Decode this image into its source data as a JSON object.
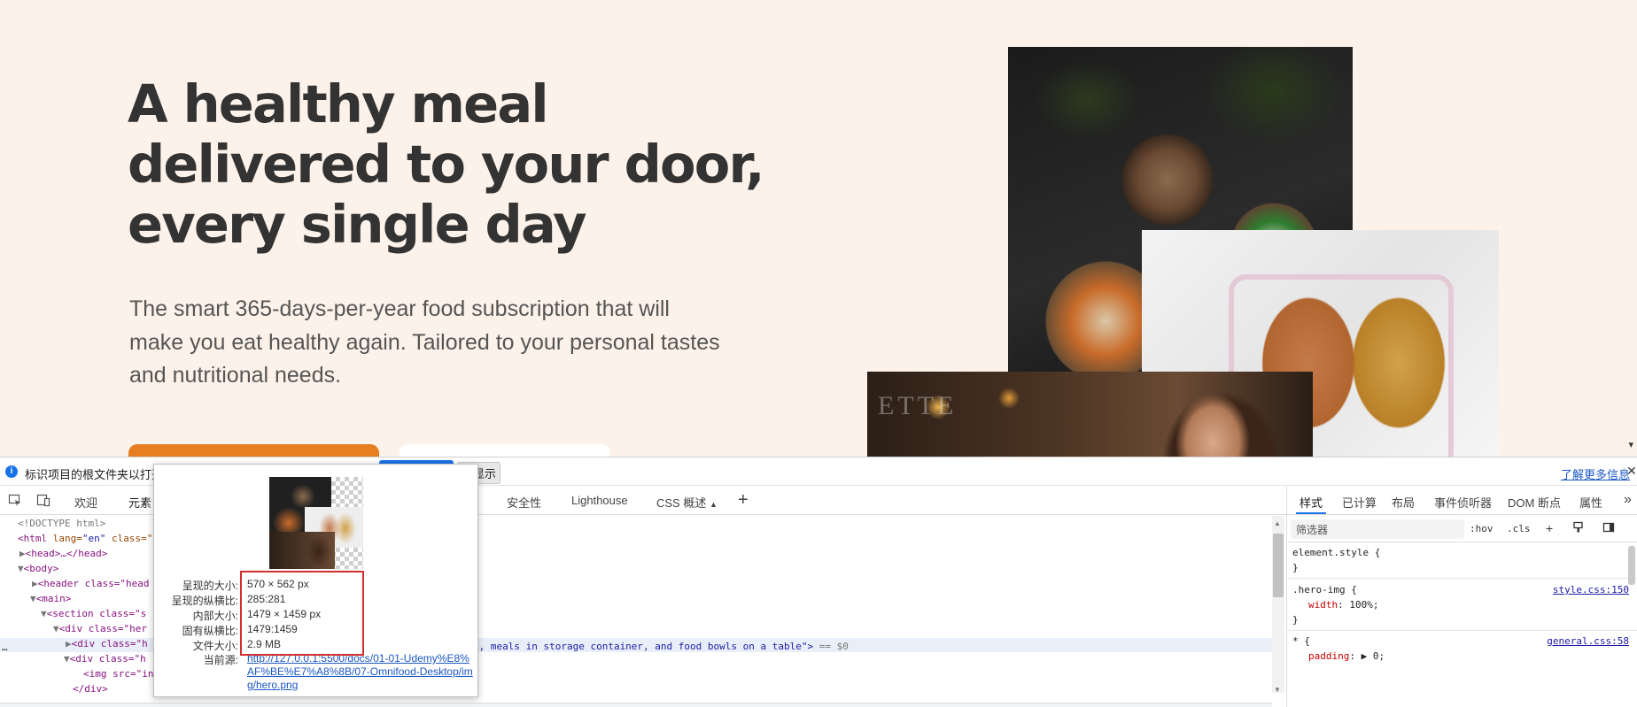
{
  "hero": {
    "title_lines": [
      "A healthy meal",
      "delivered to your door,",
      "every single day"
    ],
    "description_lines": [
      "The smart 365-days-per-year food subscription that will",
      "make you eat healthy again. Tailored to your personal tastes",
      "and nutritional needs."
    ],
    "image_sign_text": "ETTE",
    "accent_color": "#e67e22",
    "background_color": "#fdf2e9"
  },
  "infobar": {
    "icon": "info-icon",
    "message": "标识项目的根文件夹以打开",
    "button_show": "再显示",
    "learn_more": "了解更多信息",
    "close": "✕"
  },
  "devtools_tabs": {
    "inspect_icon": "inspect-icon",
    "device_icon": "device-toolbar-icon",
    "items": [
      "欢迎",
      "元素",
      "安全性",
      "Lighthouse",
      "CSS 概述"
    ],
    "css_overview_badge": "▲",
    "add": "+",
    "settings_icon": "gear-icon",
    "connect_icon": "connect-icon",
    "more": "⋯",
    "close": "✕"
  },
  "dom_lines": {
    "doctype": "<!DOCTYPE html>",
    "html_open": "<html",
    "html_attr": "lang=",
    "html_attr_val": "\"en\"",
    "html_class": "class=\"",
    "head": "<head>…</head>",
    "body": "<body>",
    "header": "<header class=\"head",
    "main": "<main>",
    "section": "<section class=\"s",
    "div_her": "<div class=\"her",
    "div_h1": "<div class=\"h",
    "div_h2": "<div class=\"h",
    "img_open": "<img src=\"in",
    "img_alt_tail": "d, meals in storage container, and food bowls on a table\">",
    "dollar": "== $0",
    "div_close": "</div>",
    "ellipsis": "…"
  },
  "styles_pane": {
    "tabs": [
      "样式",
      "已计算",
      "布局",
      "事件侦听器",
      "DOM 断点",
      "属性"
    ],
    "more": "»",
    "filter_placeholder": "筛选器",
    "hov": ":hov",
    "cls": ".cls",
    "add_rule": "+",
    "rules": {
      "element_style": "element.style {",
      "brace_close": "}",
      "hero_img_sel": ".hero-img {",
      "hero_img_prop": "width",
      "hero_img_val": "100%;",
      "hero_img_src": "style.css:150",
      "universal_sel": "* {",
      "universal_prop": "padding",
      "universal_val": "▶ 0;",
      "universal_src": "general.css:58"
    }
  },
  "image_popup": {
    "labels": [
      "呈现的大小:",
      "呈现的纵横比:",
      "内部大小:",
      "固有纵横比:",
      "文件大小:",
      "当前源:"
    ],
    "rendered_size": "570 × 562 px",
    "rendered_ratio": "285:281",
    "intrinsic_size": "1479 × 1459 px",
    "intrinsic_ratio": "1479:1459",
    "file_size": "2.9 MB",
    "current_source": "http://127.0.0.1:5500/docs/01-01-Udemy%E8%AF%BE%E7%A8%8B/07-Omnifood-Desktop/img/hero.png",
    "highlight_color": "#d32f2f"
  }
}
